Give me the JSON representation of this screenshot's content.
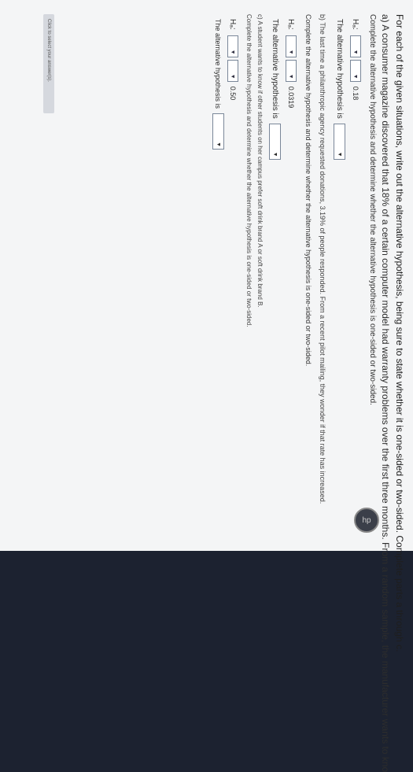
{
  "question": {
    "intro": "For each of the given situations, write out the alternative hypothesis, being sure to state whether it is one-sided or two-sided. Complete parts a through c.",
    "part_a": {
      "text": "a) A consumer magazine discovered that 18% of a certain computer model had warranty problems over the first three months. From a random sample, the manufacturer wants to kno",
      "instruction": "Complete the alternative hypothesis and determine whether the alternative hypothesis is one-sided or two-sided.",
      "h_symbol": "Hₐ:",
      "value": "0.18",
      "label": "The alternative hypothesis is"
    },
    "part_b": {
      "text": "b) The last time a philanthropic agency requested donations, 3.19% of people responded. From a recent pilot mailing, they wonder if that rate has increased.",
      "instruction": "Complete the alternative hypothesis and determine whether the alternative hypothesis is one-sided or two-sided.",
      "h_symbol": "Hₐ:",
      "value": "0.0319",
      "label": "The alternative hypothesis is"
    },
    "part_c": {
      "text": "c) A student wants to know if other students on her campus prefer soft drink brand A or soft drink brand B.",
      "instruction": "Complete the alternative hypothesis and determine whether the alternative hypothesis is one-sided or two-sided.",
      "h_symbol": "Hₐ:",
      "value": "0.50",
      "label": "The alternative hypothesis is"
    },
    "footer": "Click to select your answer(s)."
  },
  "icons": [
    "windows-icon",
    "edge-icon",
    "explorer-icon",
    "chrome-icon",
    "word-icon",
    "excel-icon",
    "powerpoint-icon"
  ],
  "brand": "hp"
}
